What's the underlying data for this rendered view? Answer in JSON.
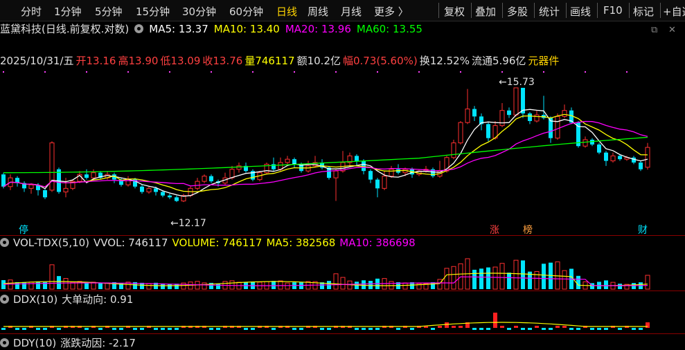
{
  "toolbar": {
    "left_tabs": [
      "分时",
      "1分钟",
      "5分钟",
      "15分钟",
      "30分钟",
      "60分钟",
      "日线",
      "周线",
      "月线",
      "更多 〉"
    ],
    "active_tab": "日线",
    "right_tabs": [
      "复权",
      "叠加",
      "多股",
      "统计",
      "画线",
      "F10",
      "标记",
      "+自选"
    ]
  },
  "chart_header": {
    "title": "蓝黛科技(日线.前复权.对数)",
    "ma5": "MA5: 13.37",
    "ma10": "MA10: 13.40",
    "ma20": "MA20: 13.96",
    "ma60": "MA60: 13.55",
    "colors": {
      "ma5": "#ffffff",
      "ma10": "#ffff00",
      "ma20": "#ff00ff",
      "ma60": "#00ff00"
    }
  },
  "window_buttons": {
    "restore": "⧉",
    "close": "✕"
  },
  "quote": {
    "date": "2025/10/31/五",
    "open": "开13.16",
    "high": "高13.90",
    "low": "低13.09",
    "close": "收13.76",
    "volume": "量746117",
    "amount": "额10.2亿",
    "change": "幅0.73(5.60%)",
    "turnover": "换12.52%",
    "float": "流通5.96亿",
    "sector": "元器件"
  },
  "price_pane": {
    "high_label": "15.73",
    "low_label": "12.17",
    "markers": [
      "停",
      "涨",
      "榜",
      "财"
    ]
  },
  "volume_pane": {
    "name": "VOL-TDX(5,10)",
    "vvol": "VVOL: 746117",
    "volume": "VOLUME: 746117",
    "ma5": "MA5: 382568",
    "ma10": "MA10: 386698"
  },
  "ddx_pane": {
    "name": "DDX(10)",
    "value": "大单动向: 0.91"
  },
  "ddy_pane": {
    "name": "DDY(10)",
    "value": "涨跌动因: -2.17"
  },
  "chart_data": {
    "type": "candlestick",
    "log_scale": true,
    "price_range": [
      11.8,
      16.1
    ],
    "candles": [
      [
        12.95,
        12.6,
        13.0,
        12.55
      ],
      [
        12.6,
        12.85,
        12.95,
        12.5
      ],
      [
        12.85,
        12.7,
        12.9,
        12.6
      ],
      [
        12.7,
        12.55,
        12.75,
        12.45
      ],
      [
        12.55,
        12.65,
        12.7,
        12.4
      ],
      [
        12.65,
        12.5,
        12.7,
        12.35
      ],
      [
        12.5,
        12.3,
        12.55,
        12.25
      ],
      [
        12.5,
        13.9,
        13.95,
        12.45
      ],
      [
        13.1,
        12.45,
        13.15,
        12.4
      ],
      [
        12.45,
        12.55,
        12.85,
        12.3
      ],
      [
        12.55,
        12.75,
        12.8,
        12.5
      ],
      [
        12.75,
        12.95,
        13.05,
        12.7
      ],
      [
        12.95,
        12.85,
        13.1,
        12.8
      ],
      [
        12.85,
        13.0,
        13.1,
        12.8
      ],
      [
        13.0,
        12.85,
        13.05,
        12.8
      ],
      [
        12.85,
        12.95,
        13.05,
        12.8
      ],
      [
        12.95,
        12.8,
        13.0,
        12.7
      ],
      [
        12.8,
        12.65,
        12.85,
        12.6
      ],
      [
        12.65,
        12.8,
        12.9,
        12.6
      ],
      [
        12.8,
        12.6,
        12.85,
        12.55
      ],
      [
        12.6,
        12.45,
        12.65,
        12.4
      ],
      [
        12.45,
        12.55,
        12.6,
        12.4
      ],
      [
        12.55,
        12.45,
        12.6,
        12.35
      ],
      [
        12.45,
        12.35,
        12.5,
        12.3
      ],
      [
        12.35,
        12.3,
        12.4,
        12.25
      ],
      [
        12.3,
        12.2,
        12.35,
        12.17
      ],
      [
        12.2,
        12.35,
        12.4,
        12.17
      ],
      [
        12.35,
        12.55,
        12.6,
        12.3
      ],
      [
        12.55,
        12.75,
        12.85,
        12.5
      ],
      [
        12.75,
        12.9,
        12.95,
        12.7
      ],
      [
        12.9,
        12.75,
        12.95,
        12.7
      ],
      [
        12.75,
        12.7,
        12.8,
        12.6
      ],
      [
        12.7,
        12.85,
        13.0,
        12.65
      ],
      [
        12.85,
        13.1,
        13.2,
        12.8
      ],
      [
        13.1,
        13.2,
        13.3,
        13.0
      ],
      [
        13.2,
        13.05,
        13.3,
        13.0
      ],
      [
        13.05,
        12.8,
        13.1,
        12.75
      ],
      [
        12.8,
        13.0,
        13.05,
        12.75
      ],
      [
        13.0,
        13.25,
        13.3,
        12.95
      ],
      [
        13.25,
        13.1,
        13.45,
        13.05
      ],
      [
        13.1,
        13.3,
        13.45,
        13.05
      ],
      [
        13.3,
        13.4,
        13.5,
        13.25
      ],
      [
        13.4,
        13.25,
        13.45,
        13.15
      ],
      [
        13.25,
        13.05,
        13.3,
        13.0
      ],
      [
        13.05,
        13.2,
        13.35,
        13.0
      ],
      [
        13.2,
        13.3,
        13.5,
        13.15
      ],
      [
        13.3,
        13.15,
        13.4,
        13.1
      ],
      [
        13.15,
        12.85,
        13.2,
        12.8
      ],
      [
        12.85,
        13.05,
        13.1,
        12.2
      ],
      [
        13.05,
        13.3,
        13.65,
        13.0
      ],
      [
        13.3,
        13.5,
        13.6,
        13.2
      ],
      [
        13.5,
        13.35,
        13.55,
        13.2
      ],
      [
        13.35,
        13.05,
        13.4,
        12.95
      ],
      [
        13.05,
        12.8,
        13.1,
        12.7
      ],
      [
        12.8,
        12.55,
        12.85,
        12.3
      ],
      [
        12.55,
        12.9,
        13.05,
        12.5
      ],
      [
        12.9,
        13.1,
        13.2,
        12.85
      ],
      [
        13.1,
        13.0,
        13.25,
        12.95
      ],
      [
        13.0,
        13.1,
        13.15,
        12.9
      ],
      [
        13.1,
        12.95,
        13.15,
        12.85
      ],
      [
        12.95,
        13.05,
        13.1,
        12.9
      ],
      [
        13.05,
        13.1,
        13.2,
        13.0
      ],
      [
        13.1,
        12.9,
        13.15,
        12.85
      ],
      [
        12.9,
        13.05,
        13.35,
        12.85
      ],
      [
        13.05,
        13.45,
        13.5,
        13.0
      ],
      [
        13.45,
        13.9,
        14.0,
        13.4
      ],
      [
        13.9,
        14.55,
        14.6,
        13.85
      ],
      [
        14.55,
        15.0,
        15.69,
        14.5
      ],
      [
        15.0,
        14.75,
        15.1,
        14.6
      ],
      [
        14.75,
        14.5,
        14.85,
        14.3
      ],
      [
        14.5,
        14.05,
        14.55,
        13.95
      ],
      [
        14.05,
        14.45,
        14.6,
        14.0
      ],
      [
        14.45,
        14.95,
        15.2,
        14.4
      ],
      [
        14.95,
        14.8,
        15.05,
        14.7
      ],
      [
        14.8,
        15.73,
        15.73,
        14.75
      ],
      [
        15.73,
        14.85,
        15.73,
        14.7
      ],
      [
        14.85,
        14.6,
        14.9,
        14.5
      ],
      [
        14.6,
        14.8,
        14.95,
        14.55
      ],
      [
        14.8,
        14.7,
        15.45,
        14.65
      ],
      [
        14.7,
        14.05,
        14.75,
        13.9
      ],
      [
        14.05,
        14.75,
        14.85,
        14.0
      ],
      [
        14.75,
        14.95,
        15.15,
        14.7
      ],
      [
        14.95,
        14.55,
        15.05,
        14.5
      ],
      [
        14.55,
        13.8,
        14.6,
        13.75
      ],
      [
        13.8,
        14.0,
        14.1,
        13.75
      ],
      [
        14.0,
        13.85,
        14.05,
        13.8
      ],
      [
        13.85,
        13.6,
        13.9,
        13.55
      ],
      [
        13.6,
        13.35,
        13.65,
        13.2
      ],
      [
        13.35,
        13.5,
        13.6,
        13.3
      ],
      [
        13.5,
        13.4,
        13.55,
        13.35
      ],
      [
        13.4,
        13.45,
        13.5,
        13.35
      ],
      [
        13.45,
        13.3,
        13.5,
        13.25
      ],
      [
        13.3,
        13.1,
        13.35,
        13.05
      ],
      [
        13.16,
        13.76,
        13.9,
        13.09
      ]
    ]
  }
}
